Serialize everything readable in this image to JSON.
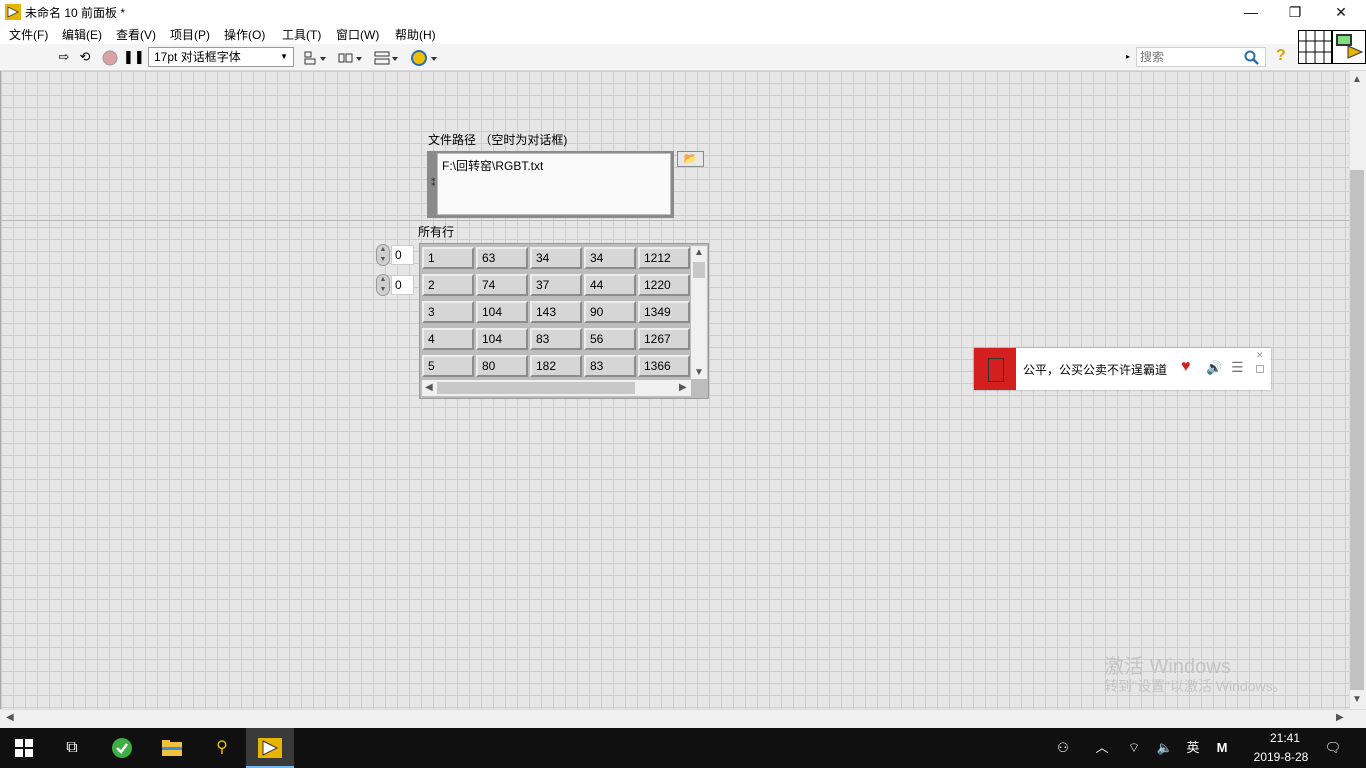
{
  "window": {
    "title": "未命名 10 前面板 *",
    "minimize_glyph": "—",
    "restore_glyph": "❐",
    "close_glyph": "✕"
  },
  "menu": [
    "文件(F)",
    "编辑(E)",
    "查看(V)",
    "项目(P)",
    "操作(O)",
    "工具(T)",
    "窗口(W)",
    "帮助(H)"
  ],
  "toolbar": {
    "font_value": "17pt 对话框字体",
    "search_placeholder": "搜索"
  },
  "file_path": {
    "label": "文件路径 （空时为对话框)",
    "value": "F:\\回转窑\\RGBT.txt"
  },
  "array": {
    "label": "所有行",
    "row_index": "0",
    "col_index": "0",
    "rows": [
      [
        "1",
        "63",
        "34",
        "34",
        "1212"
      ],
      [
        "2",
        "74",
        "37",
        "44",
        "1220"
      ],
      [
        "3",
        "104",
        "143",
        "90",
        "1349"
      ],
      [
        "4",
        "104",
        "83",
        "56",
        "1267"
      ],
      [
        "5",
        "80",
        "182",
        "83",
        "1366"
      ]
    ]
  },
  "music": {
    "song": "公平，公买公卖不许逞霸道"
  },
  "watermark": {
    "title": "激活 Windows",
    "subtitle": "转到\"设置\"以激活 Windows。"
  },
  "taskbar": {
    "ime": "英",
    "ime2": "M",
    "time": "21:41",
    "date": "2019-8-28"
  },
  "colors": {
    "music_red": "#d41f1f",
    "grid_line": "#cdcdcd",
    "panel_bg": "#e6e6e6",
    "taskbar_bg": "#101010"
  }
}
